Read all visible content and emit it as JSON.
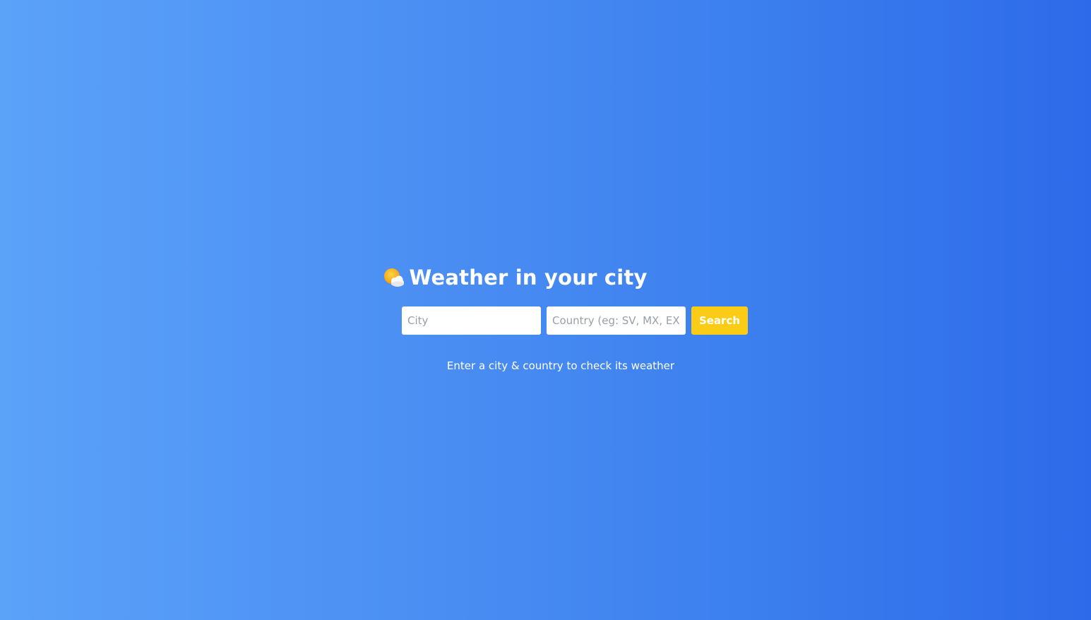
{
  "header": {
    "icon": "sun-behind-cloud-icon",
    "title": "Weather in your city"
  },
  "search": {
    "city_placeholder": "City",
    "city_value": "",
    "country_placeholder": "Country (eg: SV, MX, EX)",
    "country_value": "",
    "button_label": "Search"
  },
  "status": {
    "message": "Enter a city & country to check its weather"
  },
  "colors": {
    "background_start": "#5ba2f9",
    "background_end": "#2d6ae9",
    "button": "#facc15",
    "text": "#ffffff"
  }
}
